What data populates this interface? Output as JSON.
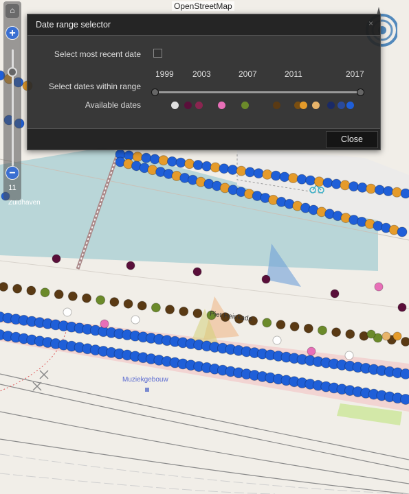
{
  "map": {
    "attribution": "OpenStreetMap",
    "labels": {
      "zuidhaven": "Zuidhaven",
      "muziekgebouw": "Muziekgebouw",
      "street_partial": "Piet Heinkade"
    },
    "zoom_level": "11"
  },
  "zoom": {
    "in_label": "+",
    "out_label": "−",
    "top_label": "⌂"
  },
  "dialog": {
    "title": "Date range selector",
    "close_x": "×",
    "most_recent_label": "Select most recent date",
    "most_recent_checked": false,
    "range_label": "Select dates within range",
    "years": [
      "1999",
      "2003",
      "2007",
      "2011",
      "2017"
    ],
    "range_min": "1999",
    "range_max": "2017",
    "available_label": "Available dates",
    "available_date_colors": [
      "#e0e0e0",
      "#5a0f3a",
      "#8a2550",
      "#e86fb8",
      "#6b8a2a",
      "#5a3a14",
      "#7a4e10",
      "#e59b2a",
      "#e8b46a",
      "#1a2a66",
      "#2a4a9a",
      "#1f5fd8"
    ],
    "close_button": "Close"
  }
}
